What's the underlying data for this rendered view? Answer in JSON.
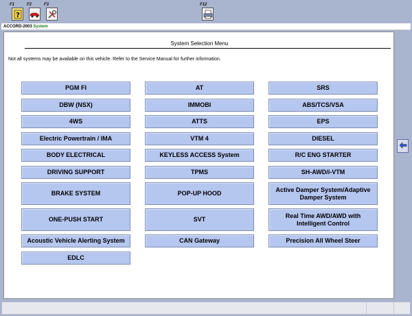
{
  "toolbar": {
    "keys": [
      {
        "label": "F1",
        "icon": "help-question-icon"
      },
      {
        "label": "F2",
        "icon": "car-icon"
      },
      {
        "label": "F3",
        "icon": "tools-icon"
      },
      {
        "label": "F12",
        "icon": "print-icon"
      }
    ]
  },
  "breadcrumb": {
    "model": "ACCORD-2003",
    "separator": " ",
    "current": "System"
  },
  "panel": {
    "title": "System Selection Menu",
    "notice": "Not all systems may be available on this vehicle. Refer to the Service Manual for further information."
  },
  "systems": {
    "col1": [
      "PGM FI",
      "DBW (NSX)",
      "4WS",
      "Electric Powertrain / IMA",
      "BODY ELECTRICAL",
      "DRIVING SUPPORT",
      "BRAKE SYSTEM",
      "ONE-PUSH START",
      "Acoustic Vehicle Alerting System",
      "EDLC"
    ],
    "col2": [
      "AT",
      "IMMOBI",
      "ATTS",
      "VTM 4",
      "KEYLESS ACCESS System",
      "TPMS",
      "POP-UP HOOD",
      "SVT",
      "CAN Gateway"
    ],
    "col3": [
      "SRS",
      "ABS/TCS/VSA",
      "EPS",
      "DIESEL",
      "R/C ENG STARTER",
      "SH-AWD/i-VTM",
      "Active Damper System/Adaptive Damper System",
      "Real Time AWD/AWD with Intelligent Control",
      "Precision All Wheel Steer"
    ]
  },
  "colors": {
    "button_fill": "#b5c6ef",
    "background": "#a9b4cf",
    "current_crumb": "#1a7a1a"
  }
}
